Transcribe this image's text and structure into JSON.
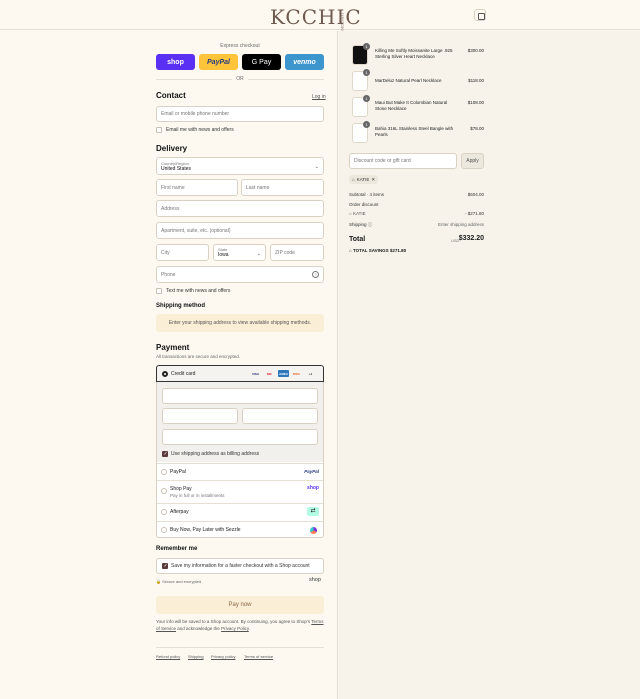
{
  "brand": {
    "logo_text": "KCCHIC",
    "logo_small": "DESIGNS"
  },
  "express": {
    "title": "Express checkout",
    "buttons": {
      "shop": "shop",
      "paypal": "PayPal",
      "gpay": "G Pay",
      "venmo": "venmo"
    },
    "or": "OR"
  },
  "contact": {
    "title": "Contact",
    "login": "Log in",
    "email_placeholder": "Email or mobile phone number",
    "news_label": "Email me with news and offers"
  },
  "delivery": {
    "title": "Delivery",
    "country_label": "Country/Region",
    "country_value": "United States",
    "first_name": "First name",
    "last_name": "Last name",
    "address": "Address",
    "apartment": "Apartment, suite, etc. (optional)",
    "city": "City",
    "state_label": "State",
    "state_value": "Iowa",
    "zip": "ZIP code",
    "phone": "Phone",
    "text_label": "Text me with news and offers"
  },
  "shipping": {
    "title": "Shipping method",
    "notice": "Enter your shipping address to view available shipping methods."
  },
  "payment": {
    "title": "Payment",
    "subtitle": "All transactions are secure and encrypted.",
    "credit_card": "Credit card",
    "card_icons": [
      "VISA",
      "MC",
      "AMEX",
      "DISC",
      "+4"
    ],
    "billing_same": "Use shipping address as billing address",
    "paypal": "PayPal",
    "paypal_logo": "PayPal",
    "shop_pay": "Shop Pay",
    "shop_pay_sub": "Pay in full or in installments",
    "shop_logo": "shop",
    "afterpay": "Afterpay",
    "sezzle": "Buy Now, Pay Later with Sezzle"
  },
  "remember": {
    "title": "Remember me",
    "save_label": "Save my information for a faster checkout with a Shop account",
    "secure": "Secure and encrypted",
    "shop_logo": "shop"
  },
  "pay_now": "Pay now",
  "legal": {
    "part1": "Your info will be saved to a Shop account. By continuing, you agree to Shop’s",
    "terms": "Terms of Service",
    "part2": "and acknowledge the",
    "privacy": "Privacy Policy",
    "end": "."
  },
  "footer": [
    "Refund policy",
    "Shipping",
    "Privacy policy",
    "Terms of service"
  ],
  "cart": {
    "items": [
      {
        "name": "Killing Me Softly Moissanite Large .925 Sterling Silver Heart Necklace",
        "price": "$300.00",
        "qty": "1"
      },
      {
        "name": "MarDeluz Natural Pearl Necklace",
        "price": "$118.00",
        "qty": "1"
      },
      {
        "name": "Maui But Make It Colombian Natural Stone Necklace",
        "price": "$108.00",
        "qty": "1"
      },
      {
        "name": "Bahia 316L Stainless Steel Bangle with Pearls",
        "price": "$78.00",
        "qty": "1"
      }
    ],
    "discount_placeholder": "Discount code or gift card",
    "apply": "Apply",
    "chip": "KATIE",
    "subtotal_label": "Subtotal · 4 items",
    "subtotal": "$604.00",
    "order_discount": "Order discount",
    "discount_code": "KATIE",
    "discount_amount": "- $271.80",
    "shipping_label": "Shipping",
    "shipping_value": "Enter shipping address",
    "total_label": "Total",
    "currency": "USD",
    "total": "$332.20",
    "savings_label": "TOTAL SAVINGS",
    "savings": "$271.80"
  },
  "colors": {
    "accent": "#5a31f4",
    "notice": "#fbeed6",
    "background": "#fdf9f1"
  }
}
